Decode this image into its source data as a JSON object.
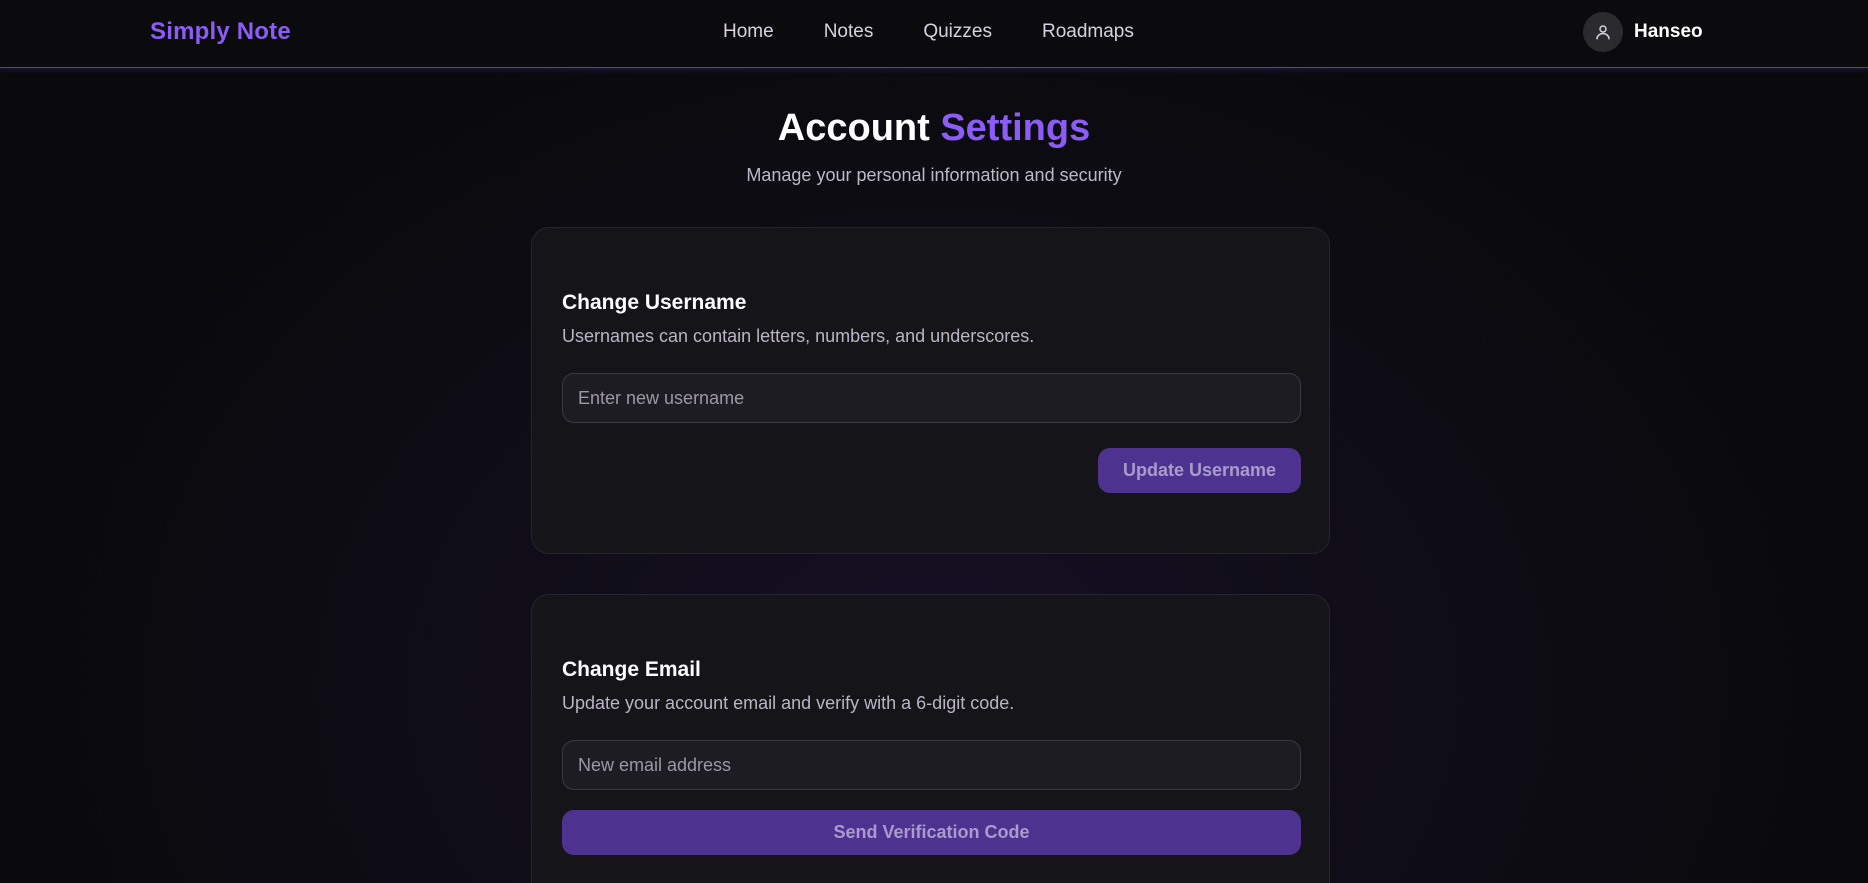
{
  "colors": {
    "accent": "#8b5cf6",
    "button_bg": "#4e3290",
    "background": "#0b0b0e",
    "card_bg": "#151419"
  },
  "navbar": {
    "brand": "Simply Note",
    "links": [
      "Home",
      "Notes",
      "Quizzes",
      "Roadmaps"
    ],
    "user": {
      "avatar_icon": "user-icon",
      "name": "Hanseo"
    }
  },
  "header": {
    "title_part1": "Account",
    "title_part2": "Settings",
    "subtitle": "Manage your personal information and security"
  },
  "username_section": {
    "title": "Change Username",
    "description": "Usernames can contain letters, numbers, and underscores.",
    "input_value": "",
    "input_placeholder": "Enter new username",
    "button_label": "Update Username"
  },
  "email_section": {
    "title": "Change Email",
    "description": "Update your account email and verify with a 6-digit code.",
    "input_value": "",
    "input_placeholder": "New email address",
    "button_label": "Send Verification Code"
  }
}
